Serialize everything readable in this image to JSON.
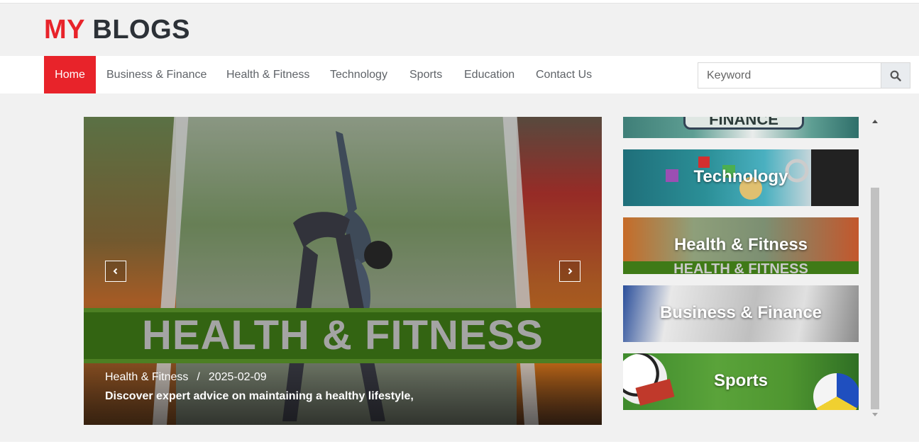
{
  "site": {
    "logo_part1": "MY",
    "logo_part2": "BLOGS",
    "brand_color": "#e8232a"
  },
  "nav": {
    "items": [
      {
        "label": "Home",
        "active": true
      },
      {
        "label": "Business & Finance"
      },
      {
        "label": "Health & Fitness"
      },
      {
        "label": "Technology"
      },
      {
        "label": "Sports"
      },
      {
        "label": "Education"
      },
      {
        "label": "Contact Us"
      }
    ]
  },
  "search": {
    "placeholder": "Keyword",
    "icon": "search-icon"
  },
  "hero": {
    "banner_text": "HEALTH & FITNESS",
    "category": "Health & Fitness",
    "separator": "/",
    "date": "2025-02-09",
    "description": "Discover expert advice on maintaining a healthy lifestyle,",
    "prev_icon": "chevron-left-icon",
    "next_icon": "chevron-right-icon"
  },
  "side_list": {
    "items": [
      {
        "title": "Technology"
      },
      {
        "title": "Health & Fitness",
        "image_text": "HEALTH & FITNESS"
      },
      {
        "title": "Business & Finance"
      },
      {
        "title": "Sports"
      }
    ],
    "top_image_text": "FINANCE"
  }
}
